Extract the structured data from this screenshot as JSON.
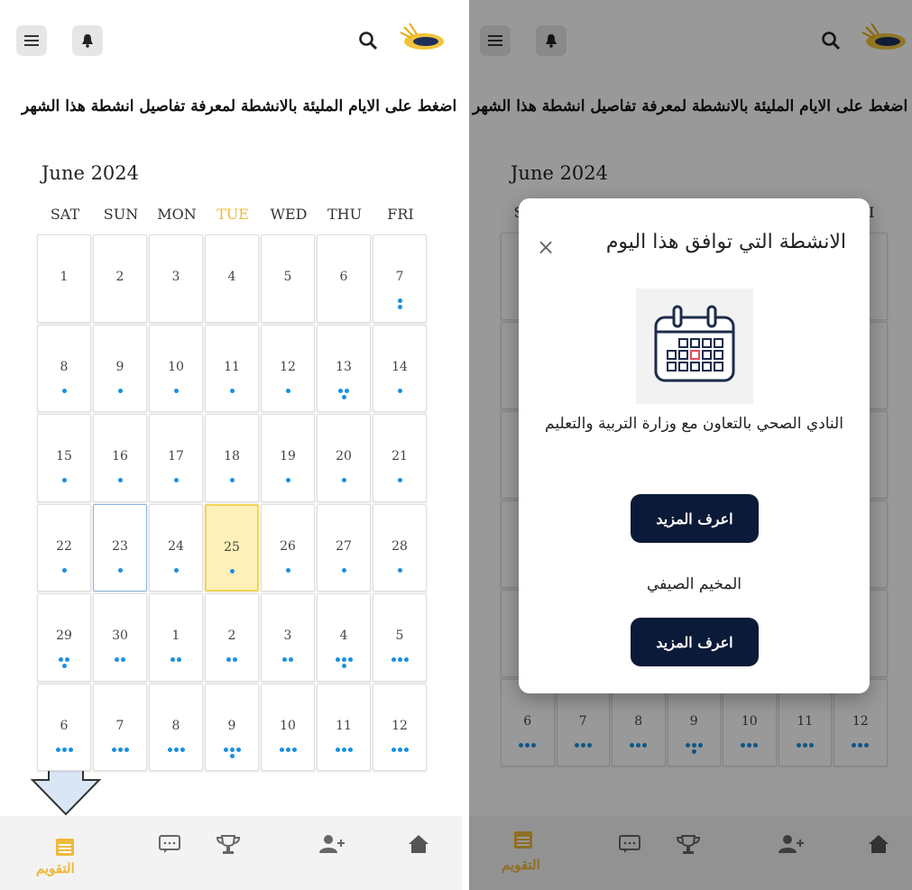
{
  "app": {
    "instruction": "اضغط على الايام المليئة بالانشطة لمعرفة تفاصيل انشطة هذا الشهر",
    "calendar_nav_label": "التقويم"
  },
  "calendar": {
    "month_label": "June 2024",
    "weekdays": [
      "SAT",
      "SUN",
      "MON",
      "TUE",
      "WED",
      "THU",
      "FRI"
    ],
    "highlight_weekday": "TUE",
    "weeks": [
      [
        {
          "d": "1",
          "n": 0
        },
        {
          "d": "2",
          "n": 0
        },
        {
          "d": "3",
          "n": 0
        },
        {
          "d": "4",
          "n": 0
        },
        {
          "d": "5",
          "n": 0
        },
        {
          "d": "6",
          "n": 0
        },
        {
          "d": "7",
          "n": 2
        }
      ],
      [
        {
          "d": "8",
          "n": 1
        },
        {
          "d": "9",
          "n": 1
        },
        {
          "d": "10",
          "n": 1
        },
        {
          "d": "11",
          "n": 1
        },
        {
          "d": "12",
          "n": 1
        },
        {
          "d": "13",
          "n": 3
        },
        {
          "d": "14",
          "n": 1
        }
      ],
      [
        {
          "d": "15",
          "n": 1
        },
        {
          "d": "16",
          "n": 1
        },
        {
          "d": "17",
          "n": 1
        },
        {
          "d": "18",
          "n": 1
        },
        {
          "d": "19",
          "n": 1
        },
        {
          "d": "20",
          "n": 1
        },
        {
          "d": "21",
          "n": 1
        }
      ],
      [
        {
          "d": "22",
          "n": 1
        },
        {
          "d": "23",
          "n": 1
        },
        {
          "d": "24",
          "n": 1
        },
        {
          "d": "25",
          "n": 1
        },
        {
          "d": "26",
          "n": 1
        },
        {
          "d": "27",
          "n": 1
        },
        {
          "d": "28",
          "n": 1
        }
      ],
      [
        {
          "d": "29",
          "n": 3
        },
        {
          "d": "30",
          "n": 2
        },
        {
          "d": "1",
          "n": 2
        },
        {
          "d": "2",
          "n": 2
        },
        {
          "d": "3",
          "n": 2
        },
        {
          "d": "4",
          "n": 4
        },
        {
          "d": "5",
          "n": 3
        }
      ],
      [
        {
          "d": "6",
          "n": 3
        },
        {
          "d": "7",
          "n": 3
        },
        {
          "d": "8",
          "n": 3
        },
        {
          "d": "9",
          "n": 4
        },
        {
          "d": "10",
          "n": 3
        },
        {
          "d": "11",
          "n": 3
        },
        {
          "d": "12",
          "n": 3
        }
      ]
    ],
    "selected_date": "23",
    "today_date": "25"
  },
  "modal": {
    "title": "الانشطة التي توافق هذا اليوم",
    "close_symbol": "×",
    "activities": [
      {
        "name": "النادي الصحي بالتعاون مع وزارة التربية والتعليم",
        "button": "اعرف المزيد"
      },
      {
        "name": "المخيم الصيفي",
        "button": "اعرف المزيد"
      }
    ]
  },
  "icons": [
    "menu-icon",
    "bell-icon",
    "search-icon",
    "logo-icon",
    "calendar-icon",
    "chat-icon",
    "trophy-icon",
    "add-user-icon",
    "home-icon",
    "arrow-down-icon"
  ],
  "colors": {
    "accent_gold": "#f0b93a",
    "event_dot": "#1a8fe0",
    "today_bg": "#fdf0b8",
    "button_dark": "#0b1a38"
  }
}
